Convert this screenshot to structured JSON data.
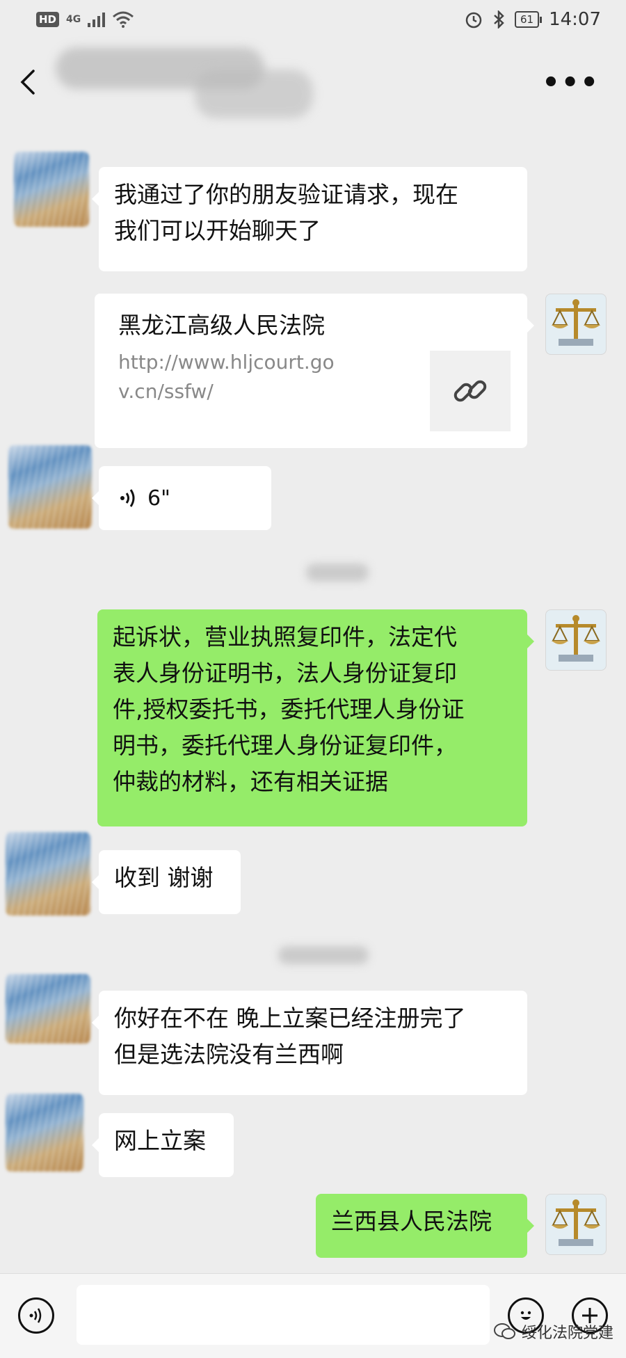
{
  "status_bar": {
    "hd_label": "HD",
    "network": "4G",
    "battery": "61",
    "time": "14:07"
  },
  "header": {
    "more_label": "•••"
  },
  "messages": [
    {
      "side": "left",
      "text": "我通过了你的朋友验证请求，现在\n我们可以开始聊天了"
    },
    {
      "side": "right",
      "type": "link",
      "title": "黑龙江高级人民法院",
      "url": "http://www.hljcourt.gov.cn/ssfw/"
    },
    {
      "side": "left",
      "type": "voice",
      "duration": "6\""
    },
    {
      "side": "right",
      "text": "起诉状，营业执照复印件，法定代\n表人身份证明书，法人身份证复印\n件,授权委托书，委托代理人身份证\n明书，委托代理人身份证复印件，\n仲裁的材料，还有相关证据"
    },
    {
      "side": "left",
      "text": "收到 谢谢"
    },
    {
      "side": "left",
      "text": "你好在不在 晚上立案已经注册完了\n但是选法院没有兰西啊"
    },
    {
      "side": "left",
      "text": "网上立案"
    },
    {
      "side": "right",
      "text": "兰西县人民法院"
    }
  ],
  "watermark": "绥化法院党建",
  "colors": {
    "background": "#ededed",
    "green_bubble": "#95ec69",
    "white_bubble": "#ffffff"
  }
}
